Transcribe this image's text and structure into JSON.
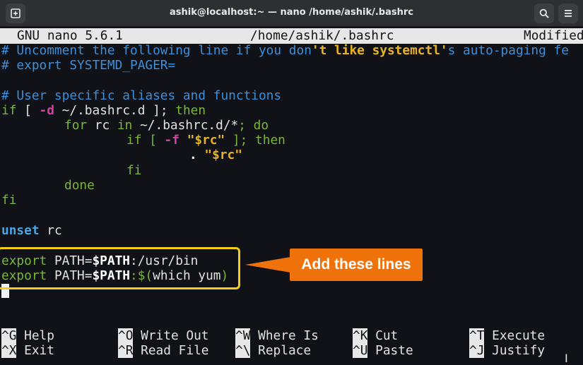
{
  "window": {
    "title": "ashik@localhost:~ — nano /home/ashik/.bashrc"
  },
  "nano": {
    "app": "GNU nano 5.6.1",
    "file": "/home/ashik/.bashrc",
    "status": "Modified"
  },
  "code": {
    "l1_a": "# Uncomment the following line if you don",
    "l1_b": "'t like systemctl'",
    "l1_c": "s auto-paging fe",
    "l2": "# export SYSTEMD_PAGER=",
    "l4": "# User specific aliases and functions",
    "l5_if": "if",
    "l5_br": " [ ",
    "l5_d": "-d",
    "l5_path": " ~/.bashrc.d ]; ",
    "l5_then": "then",
    "l6_for": "for",
    "l6_rc": " rc ",
    "l6_in": "in",
    "l6_path": " ~/.bashrc.d/*",
    "l6_semi": "; ",
    "l6_do": "do",
    "l7_if": "if",
    "l7_br": " [ ",
    "l7_f": "-f",
    "l7_sp": " ",
    "l7_str": "\"$rc\"",
    "l7_close": " ]; ",
    "l7_then": "then",
    "l8_dot": ". ",
    "l8_str": "\"$rc\"",
    "l9": "fi",
    "l10": "done",
    "l11": "fi",
    "l13_unset": "unset",
    "l13_rc": " rc",
    "l15_export": "export",
    "l15_path": " PATH=",
    "l15_var": "$PATH",
    "l15_rest": ":/usr/bin",
    "l16_export": "export",
    "l16_path": " PATH=",
    "l16_var": "$PATH",
    "l16_colon": ":",
    "l16_sub": "$(",
    "l16_cmd": "which yum",
    "l16_end": ")"
  },
  "annotation": {
    "text": "Add these lines"
  },
  "shortcuts": [
    {
      "key": "^G",
      "label": "Help"
    },
    {
      "key": "^O",
      "label": "Write Out"
    },
    {
      "key": "^W",
      "label": "Where Is"
    },
    {
      "key": "^K",
      "label": "Cut"
    },
    {
      "key": "^T",
      "label": "Execute"
    },
    {
      "key": "^X",
      "label": "Exit"
    },
    {
      "key": "^R",
      "label": "Read File"
    },
    {
      "key": "^\\",
      "label": "Replace"
    },
    {
      "key": "^U",
      "label": "Paste"
    },
    {
      "key": "^J",
      "label": "Justify"
    }
  ],
  "icons": {
    "new_tab": "new-tab-icon",
    "search": "search-icon",
    "menu": "hamburger-menu-icon"
  }
}
